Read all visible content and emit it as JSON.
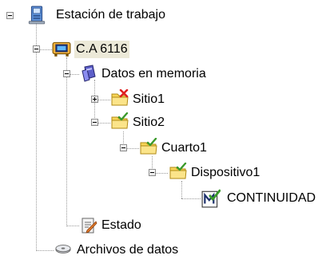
{
  "tree": {
    "root": {
      "label": "Estación de trabajo",
      "icon": "workstation-icon"
    },
    "device": {
      "label": "C.A 6116",
      "icon": "instrument-icon",
      "selected": true
    },
    "memory": {
      "label": "Datos en memoria",
      "icon": "memory-data-icon"
    },
    "site1": {
      "label": "Sitio1",
      "icon": "folder-red-x-icon",
      "expanded": false
    },
    "site2": {
      "label": "Sitio2",
      "icon": "folder-check-icon",
      "expanded": true
    },
    "room1": {
      "label": "Cuarto1",
      "icon": "folder-check-icon",
      "expanded": true
    },
    "device1": {
      "label": "Dispositivo1",
      "icon": "folder-check-icon",
      "expanded": true
    },
    "continuity": {
      "label": "CONTINUIDAD",
      "icon": "measurement-check-icon"
    },
    "status": {
      "label": "Estado",
      "icon": "status-report-icon"
    },
    "files": {
      "label": "Archivos de datos",
      "icon": "disk-drive-icon"
    }
  },
  "colors": {
    "folder": "#f7d558",
    "check": "#3a9a2b",
    "error": "#e02020",
    "selection": "#ece9d8"
  }
}
